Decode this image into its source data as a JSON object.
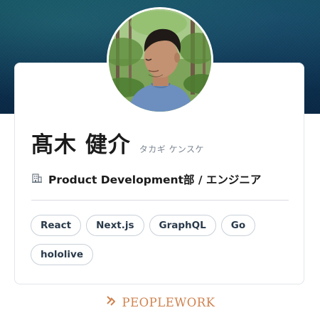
{
  "profile": {
    "name": "髙木 健介",
    "kana": "タカギ ケンスケ",
    "department": "Product Development部 / エンジニア"
  },
  "skills": [
    "React",
    "Next.js",
    "GraphQL",
    "Go",
    "hololive"
  ],
  "footer": {
    "brand": "PEOPLEWORK"
  },
  "icons": {
    "department": "building-icon",
    "brand": "peoplework-logo-icon"
  },
  "colors": {
    "hero": "#0c3350",
    "brand": "#cf8350",
    "tag_border": "#c9d1d9",
    "text": "#1b1b1b"
  }
}
